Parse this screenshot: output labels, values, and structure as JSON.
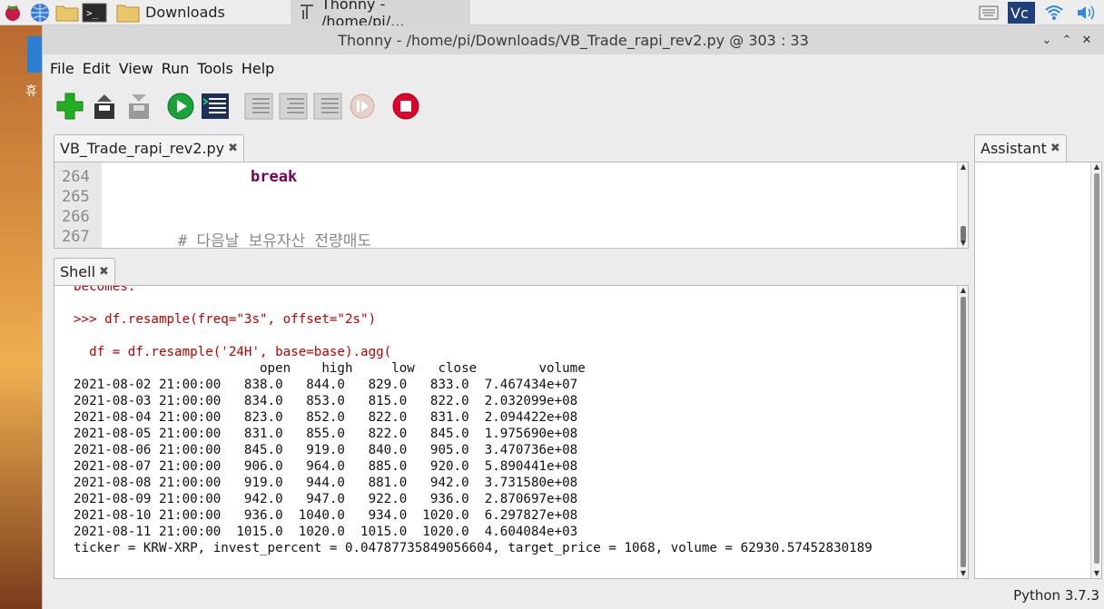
{
  "taskbar": {
    "downloads_label": "Downloads",
    "thonny_label": "Thonny  -  /home/pi/..."
  },
  "desktop": {
    "icon_label": "휴"
  },
  "window": {
    "title": "Thonny  -  /home/pi/Downloads/VB_Trade_rapi_rev2.py  @  303 : 33"
  },
  "menu": [
    "File",
    "Edit",
    "View",
    "Run",
    "Tools",
    "Help"
  ],
  "editor": {
    "tab_label": "VB_Trade_rapi_rev2.py",
    "lines": [
      {
        "no": "264",
        "code": "break"
      },
      {
        "no": "265",
        "code": ""
      },
      {
        "no": "266",
        "code": ""
      },
      {
        "no": "267",
        "code": "# 다음날 보유자산 전량매도"
      }
    ]
  },
  "shell": {
    "tab_label": "Shell",
    "line_becomes": "becomes:",
    "line_prompt": ">>> df.resample(freq=\"3s\", offset=\"2s\")",
    "line_code": "  df = df.resample('24H', base=base).agg(",
    "header": "                        open    high     low   close        volume",
    "rows": [
      "2021-08-02 21:00:00   838.0   844.0   829.0   833.0  7.467434e+07",
      "2021-08-03 21:00:00   834.0   853.0   815.0   822.0  2.032099e+08",
      "2021-08-04 21:00:00   823.0   852.0   822.0   831.0  2.094422e+08",
      "2021-08-05 21:00:00   831.0   855.0   822.0   845.0  1.975690e+08",
      "2021-08-06 21:00:00   845.0   919.0   840.0   905.0  3.470736e+08",
      "2021-08-07 21:00:00   906.0   964.0   885.0   920.0  5.890441e+08",
      "2021-08-08 21:00:00   919.0   944.0   881.0   942.0  3.731580e+08",
      "2021-08-09 21:00:00   942.0   947.0   922.0   936.0  2.870697e+08",
      "2021-08-10 21:00:00   936.0  1040.0   934.0  1020.0  6.297827e+08",
      "2021-08-11 21:00:00  1015.0  1020.0  1015.0  1020.0  4.604084e+03"
    ],
    "ticker_line": "ticker = KRW-XRP, invest_percent = 0.04787735849056604, target_price = 1068, volume = 62930.57452830189"
  },
  "assistant": {
    "tab_label": "Assistant"
  },
  "status": {
    "python_version": "Python 3.7.3"
  },
  "icons": {
    "close_glyph": "✖",
    "colors": {
      "run_green": "#1aa339",
      "stop_red": "#e0002a",
      "new_green": "#22b022"
    }
  }
}
